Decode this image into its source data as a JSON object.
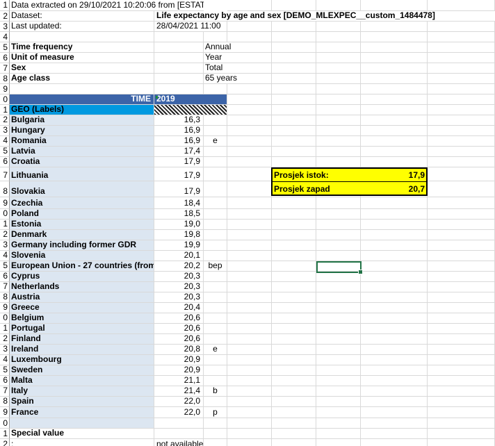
{
  "meta": {
    "extracted": "Data extracted on 29/10/2021 10:20:06 from [ESTAT]",
    "dataset_label": "Dataset:",
    "dataset_value": "Life expectancy by age and sex [DEMO_MLEXPEC__custom_1484478]",
    "updated_label": "Last updated:",
    "updated_value": "28/04/2021 11:00",
    "params": [
      {
        "label": "Time frequency",
        "value": "Annual"
      },
      {
        "label": "Unit of measure",
        "value": "Year"
      },
      {
        "label": "Sex",
        "value": "Total"
      },
      {
        "label": "Age class",
        "value": "65 years"
      }
    ]
  },
  "table": {
    "time_label": "TIME",
    "year": "2019",
    "geo_label": "GEO (Labels)",
    "rows": [
      {
        "rn": "2",
        "geo": "Bulgaria",
        "value": "16,3",
        "flag": ""
      },
      {
        "rn": "3",
        "geo": "Hungary",
        "value": "16,9",
        "flag": ""
      },
      {
        "rn": "4",
        "geo": "Romania",
        "value": "16,9",
        "flag": "e"
      },
      {
        "rn": "5",
        "geo": "Latvia",
        "value": "17,4",
        "flag": ""
      },
      {
        "rn": "6",
        "geo": "Croatia",
        "value": "17,9",
        "flag": ""
      },
      {
        "rn": "7",
        "geo": "Lithuania",
        "value": "17,9",
        "flag": ""
      },
      {
        "rn": "8",
        "geo": "Slovakia",
        "value": "17,9",
        "flag": ""
      },
      {
        "rn": "9",
        "geo": "Czechia",
        "value": "18,4",
        "flag": ""
      },
      {
        "rn": "0",
        "geo": "Poland",
        "value": "18,5",
        "flag": ""
      },
      {
        "rn": "1",
        "geo": "Estonia",
        "value": "19,0",
        "flag": ""
      },
      {
        "rn": "2",
        "geo": "Denmark",
        "value": "19,8",
        "flag": ""
      },
      {
        "rn": "3",
        "geo": "Germany including former GDR",
        "value": "19,9",
        "flag": ""
      },
      {
        "rn": "4",
        "geo": "Slovenia",
        "value": "20,1",
        "flag": ""
      },
      {
        "rn": "5",
        "geo": "European Union - 27 countries (from",
        "value": "20,2",
        "flag": "bep"
      },
      {
        "rn": "6",
        "geo": "Cyprus",
        "value": "20,3",
        "flag": ""
      },
      {
        "rn": "7",
        "geo": "Netherlands",
        "value": "20,3",
        "flag": ""
      },
      {
        "rn": "8",
        "geo": "Austria",
        "value": "20,3",
        "flag": ""
      },
      {
        "rn": "9",
        "geo": "Greece",
        "value": "20,4",
        "flag": ""
      },
      {
        "rn": "0",
        "geo": "Belgium",
        "value": "20,6",
        "flag": ""
      },
      {
        "rn": "1",
        "geo": "Portugal",
        "value": "20,6",
        "flag": ""
      },
      {
        "rn": "2",
        "geo": "Finland",
        "value": "20,6",
        "flag": ""
      },
      {
        "rn": "3",
        "geo": "Ireland",
        "value": "20,8",
        "flag": "e"
      },
      {
        "rn": "4",
        "geo": "Luxembourg",
        "value": "20,9",
        "flag": ""
      },
      {
        "rn": "5",
        "geo": "Sweden",
        "value": "20,9",
        "flag": ""
      },
      {
        "rn": "6",
        "geo": "Malta",
        "value": "21,1",
        "flag": ""
      },
      {
        "rn": "7",
        "geo": "Italy",
        "value": "21,4",
        "flag": "b"
      },
      {
        "rn": "8",
        "geo": "Spain",
        "value": "22,0",
        "flag": ""
      },
      {
        "rn": "9",
        "geo": "France",
        "value": "22,0",
        "flag": "p"
      }
    ]
  },
  "footer": {
    "special_label": "Special value",
    "colon": ":",
    "not_available": "not available"
  },
  "summary": {
    "east_label": "Prosjek istok:",
    "east_value": "17,9",
    "west_label": "Prosjek zapad",
    "west_value": "20,7"
  },
  "row_numbers": {
    "r1": "1",
    "r2": "2",
    "r3": "3",
    "r4": "4",
    "r5": "5",
    "r6": "6",
    "r7": "7",
    "r8": "8",
    "r9": "9",
    "r10": "0",
    "r11": "1",
    "r40": "0",
    "r41": "1",
    "r42": "2"
  },
  "colors": {
    "geo_fill": "#dce6f1",
    "geo_header": "#0099e0",
    "time_header": "#3c64a8",
    "highlight": "#ffff00",
    "selection": "#217346"
  }
}
